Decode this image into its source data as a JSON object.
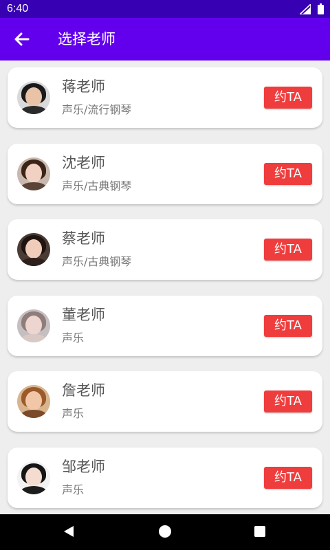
{
  "status_bar": {
    "time": "6:40"
  },
  "app_bar": {
    "title": "选择老师",
    "back_icon": "arrow-back-icon"
  },
  "teachers": [
    {
      "name": "蒋老师",
      "subject": "声乐/流行钢琴",
      "button": "约TA",
      "hair": "#1a1a1a",
      "face": "#e8c3a8",
      "body": "#2a2a2a",
      "bg": "#d9d9d9"
    },
    {
      "name": "沈老师",
      "subject": "声乐/古典钢琴",
      "button": "约TA",
      "hair": "#3b2418",
      "face": "#f1d2c2",
      "body": "#5a4438",
      "bg": "#c9b8ae"
    },
    {
      "name": "蔡老师",
      "subject": "声乐/古典钢琴",
      "button": "约TA",
      "hair": "#1f1410",
      "face": "#f0cdbb",
      "body": "#2d1f1a",
      "bg": "#4a3b35"
    },
    {
      "name": "董老师",
      "subject": "声乐",
      "button": "约TA",
      "hair": "#8f7d7a",
      "face": "#ecd6cf",
      "body": "#d8c9c4",
      "bg": "#c6bfc1"
    },
    {
      "name": "詹老师",
      "subject": "声乐",
      "button": "约TA",
      "hair": "#9a5a2a",
      "face": "#f2c7a8",
      "body": "#7a4a2a",
      "bg": "#d8b58f"
    },
    {
      "name": "邹老师",
      "subject": "声乐",
      "button": "约TA",
      "hair": "#151515",
      "face": "#f5dcd0",
      "body": "#1c1c1c",
      "bg": "#f2f2f2"
    }
  ],
  "colors": {
    "status_bar": "#3700b3",
    "app_bar": "#6200ee",
    "button": "#ef3d3d"
  }
}
